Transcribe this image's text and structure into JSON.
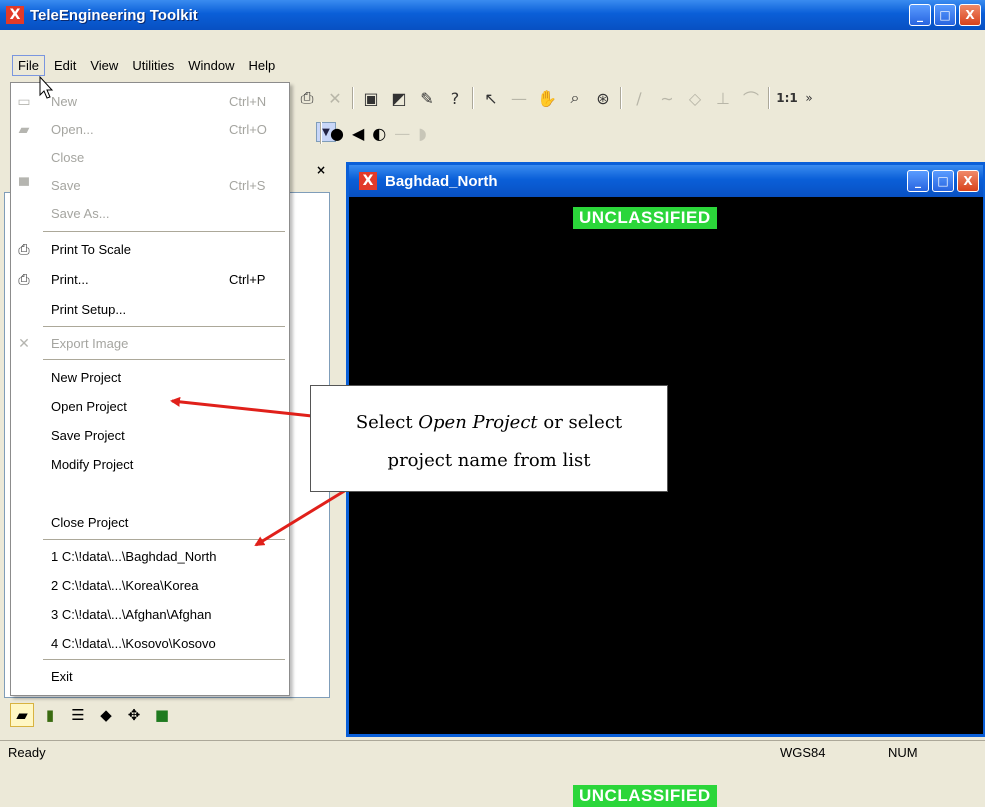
{
  "window": {
    "title": "TeleEngineering Toolkit",
    "app_icon_glyph": "X",
    "controls": {
      "minimize": "_",
      "maximize": "□",
      "close": "X"
    }
  },
  "menubar": [
    "File",
    "Edit",
    "View",
    "Utilities",
    "Window",
    "Help"
  ],
  "toolbar": {
    "zoom_label": "1:1",
    "overflow": "»"
  },
  "file_menu": {
    "items": [
      {
        "label": "New",
        "shortcut": "Ctrl+N",
        "enabled": false,
        "icon": "new-document-icon",
        "glyph": "▭"
      },
      {
        "label": "Open...",
        "shortcut": "Ctrl+O",
        "enabled": false,
        "icon": "open-folder-icon",
        "glyph": "▰"
      },
      {
        "label": "Close",
        "shortcut": "",
        "enabled": false,
        "icon": "",
        "glyph": ""
      },
      {
        "label": "Save",
        "shortcut": "Ctrl+S",
        "enabled": false,
        "icon": "save-disk-icon",
        "glyph": "▀"
      },
      {
        "label": "Save As...",
        "shortcut": "",
        "enabled": false,
        "icon": "",
        "glyph": ""
      },
      {
        "label": "Print To Scale",
        "shortcut": "",
        "enabled": true,
        "icon": "printer-icon",
        "glyph": "⎙"
      },
      {
        "label": "Print...",
        "shortcut": "Ctrl+P",
        "enabled": true,
        "icon": "printer-icon",
        "glyph": "⎙"
      },
      {
        "label": "Print Setup...",
        "shortcut": "",
        "enabled": true,
        "icon": "",
        "glyph": ""
      },
      {
        "label": "Export Image",
        "shortcut": "",
        "enabled": false,
        "icon": "export-image-icon",
        "glyph": "✕"
      },
      {
        "label": "New Project",
        "shortcut": "",
        "enabled": true,
        "icon": "",
        "glyph": ""
      },
      {
        "label": "Open Project",
        "shortcut": "",
        "enabled": true,
        "icon": "",
        "glyph": ""
      },
      {
        "label": "Save Project",
        "shortcut": "",
        "enabled": true,
        "icon": "",
        "glyph": ""
      },
      {
        "label": "Modify Project",
        "shortcut": "",
        "enabled": true,
        "icon": "",
        "glyph": ""
      },
      {
        "label": "Close Project",
        "shortcut": "",
        "enabled": true,
        "icon": "",
        "glyph": ""
      },
      {
        "label": "1 C:\\!data\\...\\Baghdad_North",
        "shortcut": "",
        "enabled": true,
        "icon": "",
        "glyph": ""
      },
      {
        "label": "2 C:\\!data\\...\\Korea\\Korea",
        "shortcut": "",
        "enabled": true,
        "icon": "",
        "glyph": ""
      },
      {
        "label": "3 C:\\!data\\...\\Afghan\\Afghan",
        "shortcut": "",
        "enabled": true,
        "icon": "",
        "glyph": ""
      },
      {
        "label": "4 C:\\!data\\...\\Kosovo\\Kosovo",
        "shortcut": "",
        "enabled": true,
        "icon": "",
        "glyph": ""
      },
      {
        "label": "Exit",
        "shortcut": "",
        "enabled": true,
        "icon": "",
        "glyph": ""
      }
    ]
  },
  "child_window": {
    "title": "Baghdad_North",
    "banner_top": "UNCLASSIFIED",
    "banner_bottom": "UNCLASSIFIED"
  },
  "callout": {
    "line1_prefix": "Select ",
    "line1_emphasis": "Open Project",
    "line1_suffix": " or select",
    "line2": "project name from list"
  },
  "statusbar": {
    "text": "Ready",
    "datum": "WGS84",
    "numlock": "NUM"
  },
  "colors": {
    "title_blue": "#0a5fd8",
    "banner_green": "#2bd63a",
    "arrow_red": "#e0201a",
    "map_background": "#000000"
  }
}
